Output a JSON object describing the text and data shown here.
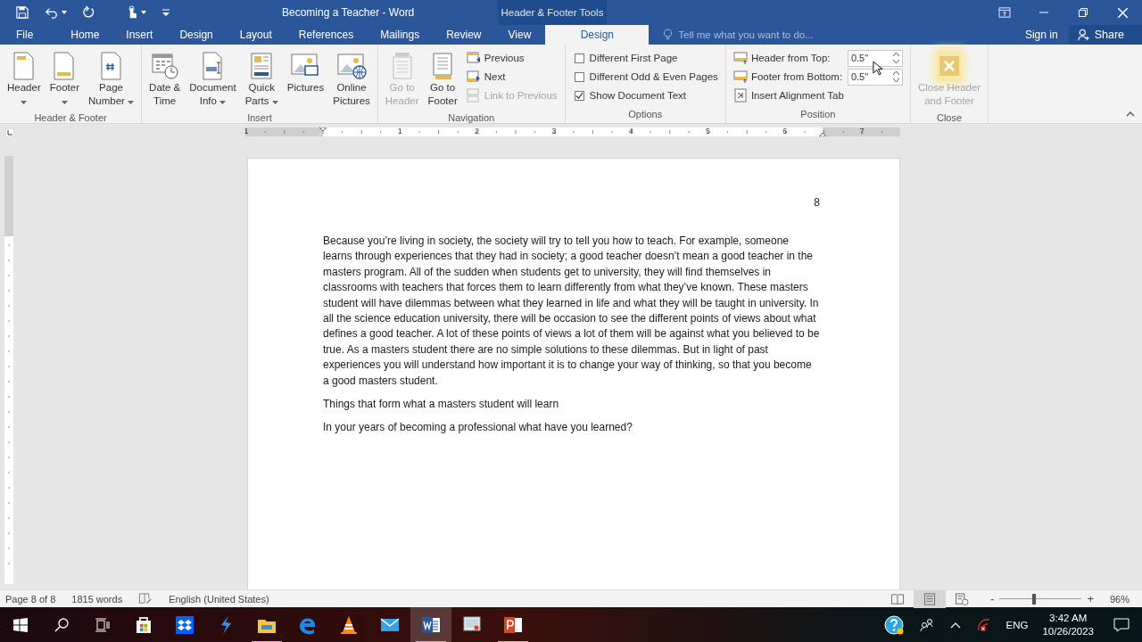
{
  "window": {
    "title": "Becoming a Teacher - Word",
    "context_title": "Header & Footer Tools"
  },
  "tabs": [
    {
      "label": "File",
      "selected": false
    },
    {
      "label": "Home",
      "selected": false
    },
    {
      "label": "Insert",
      "selected": false
    },
    {
      "label": "Design",
      "selected": false
    },
    {
      "label": "Layout",
      "selected": false
    },
    {
      "label": "References",
      "selected": false
    },
    {
      "label": "Mailings",
      "selected": false
    },
    {
      "label": "Review",
      "selected": false
    },
    {
      "label": "View",
      "selected": false
    },
    {
      "label": "Design",
      "selected": true
    }
  ],
  "tell_me": {
    "placeholder": "Tell me what you want to do..."
  },
  "sign_in": "Sign in",
  "share": "Share",
  "ribbon": [
    {
      "name": "Header & Footer",
      "columns": [
        {
          "kind": "large",
          "lines": [
            "Header"
          ],
          "dropdown": true,
          "disabled": false,
          "hovered": false
        },
        {
          "kind": "large",
          "lines": [
            "Footer"
          ],
          "dropdown": true,
          "disabled": false,
          "hovered": false
        },
        {
          "kind": "large",
          "lines": [
            "Page",
            "Number"
          ],
          "dropdown": true,
          "disabled": false,
          "hovered": false
        }
      ]
    },
    {
      "name": "Insert",
      "columns": [
        {
          "kind": "large",
          "lines": [
            "Date &",
            "Time"
          ],
          "dropdown": false,
          "disabled": false,
          "hovered": false
        },
        {
          "kind": "large",
          "lines": [
            "Document",
            "Info"
          ],
          "dropdown": true,
          "disabled": false,
          "hovered": false
        },
        {
          "kind": "large",
          "lines": [
            "Quick",
            "Parts"
          ],
          "dropdown": true,
          "disabled": false,
          "hovered": false
        },
        {
          "kind": "large",
          "lines": [
            "Pictures"
          ],
          "dropdown": false,
          "disabled": false,
          "hovered": false
        },
        {
          "kind": "large",
          "lines": [
            "Online",
            "Pictures"
          ],
          "dropdown": false,
          "disabled": false,
          "hovered": false
        }
      ]
    },
    {
      "name": "Navigation",
      "columns": [
        {
          "kind": "large",
          "lines": [
            "Go to",
            "Header"
          ],
          "dropdown": false,
          "disabled": true,
          "hovered": false
        },
        {
          "kind": "large",
          "lines": [
            "Go to",
            "Footer"
          ],
          "dropdown": false,
          "disabled": false,
          "hovered": false
        },
        {
          "kind": "stack",
          "rows": [
            {
              "kind": "small",
              "label": "Previous",
              "disabled": false
            },
            {
              "kind": "small",
              "label": "Next",
              "disabled": false
            },
            {
              "kind": "small",
              "label": "Link to Previous",
              "disabled": true
            }
          ]
        }
      ]
    },
    {
      "name": "Options",
      "columns": [
        {
          "kind": "stack",
          "rows": [
            {
              "kind": "checkbox",
              "label": "Different First Page",
              "checked": false
            },
            {
              "kind": "checkbox",
              "label": "Different Odd & Even Pages",
              "checked": false
            },
            {
              "kind": "checkbox",
              "label": "Show Document Text",
              "checked": true
            }
          ]
        }
      ]
    },
    {
      "name": "Position",
      "columns": [
        {
          "kind": "stack",
          "rows": [
            {
              "kind": "spin",
              "label": "Header from Top:",
              "value": "0.5\""
            },
            {
              "kind": "spin",
              "label": "Footer from Bottom:",
              "value": "0.5\""
            },
            {
              "kind": "small",
              "label": "Insert Alignment Tab",
              "disabled": false
            }
          ]
        }
      ]
    },
    {
      "name": "Close",
      "columns": [
        {
          "kind": "large",
          "lines": [
            "Close Header",
            "and Footer"
          ],
          "dropdown": false,
          "disabled": false,
          "hovered": true
        }
      ]
    }
  ],
  "ruler": {
    "labels": [
      "1",
      "1",
      "2",
      "3",
      "4",
      "5",
      "6",
      "7"
    ]
  },
  "document": {
    "page_number": "8",
    "paragraphs": [
      "Because you’re living in society, the society will try to tell you how to teach. For example, someone learns through experiences that they had in society; a good teacher doesn’t mean a good teacher  in the masters program. All of the sudden when students get to university, they will find themselves in classrooms with teachers that forces them to learn differently from what they’ve known. These masters student will have dilemmas between what they learned in life and what they will be taught in university. In all the science education university, there will be occasion to see the different points of views about what defines a good teacher. A lot of these points of views a lot of them will be against what you believed to be true. As a masters student there are no simple solutions to these dilemmas. But in light of past experiences you will understand how important it is to change your way of thinking, so that you become a good masters student.",
      "Things that form what a masters student will learn",
      "In your years of becoming a professional what have you learned?"
    ]
  },
  "status_bar": {
    "page": "Page 8 of 8",
    "words": "1815 words",
    "language": "English (United States)",
    "views": [
      {
        "kind": "read",
        "selected": false
      },
      {
        "kind": "print",
        "selected": true
      },
      {
        "kind": "web",
        "selected": false
      }
    ],
    "zoom": {
      "minus": "-",
      "plus": "+",
      "level": 0.42,
      "percent": "96%"
    }
  },
  "taskbar": {
    "apps": [
      {
        "kind": "store",
        "running": false,
        "active": false
      },
      {
        "kind": "dropbox",
        "running": false,
        "active": false
      },
      {
        "kind": "bolt",
        "running": false,
        "active": false
      },
      {
        "kind": "folder",
        "running": true,
        "active": false
      },
      {
        "kind": "edge",
        "running": false,
        "active": false
      },
      {
        "kind": "cone",
        "running": false,
        "active": false
      },
      {
        "kind": "mail",
        "running": false,
        "active": false
      },
      {
        "kind": "word",
        "running": true,
        "active": true
      },
      {
        "kind": "remote",
        "running": false,
        "active": false
      },
      {
        "kind": "powerpoint",
        "running": true,
        "active": false
      }
    ],
    "language": "ENG",
    "time": "3:42 AM",
    "date": "10/26/2023"
  }
}
